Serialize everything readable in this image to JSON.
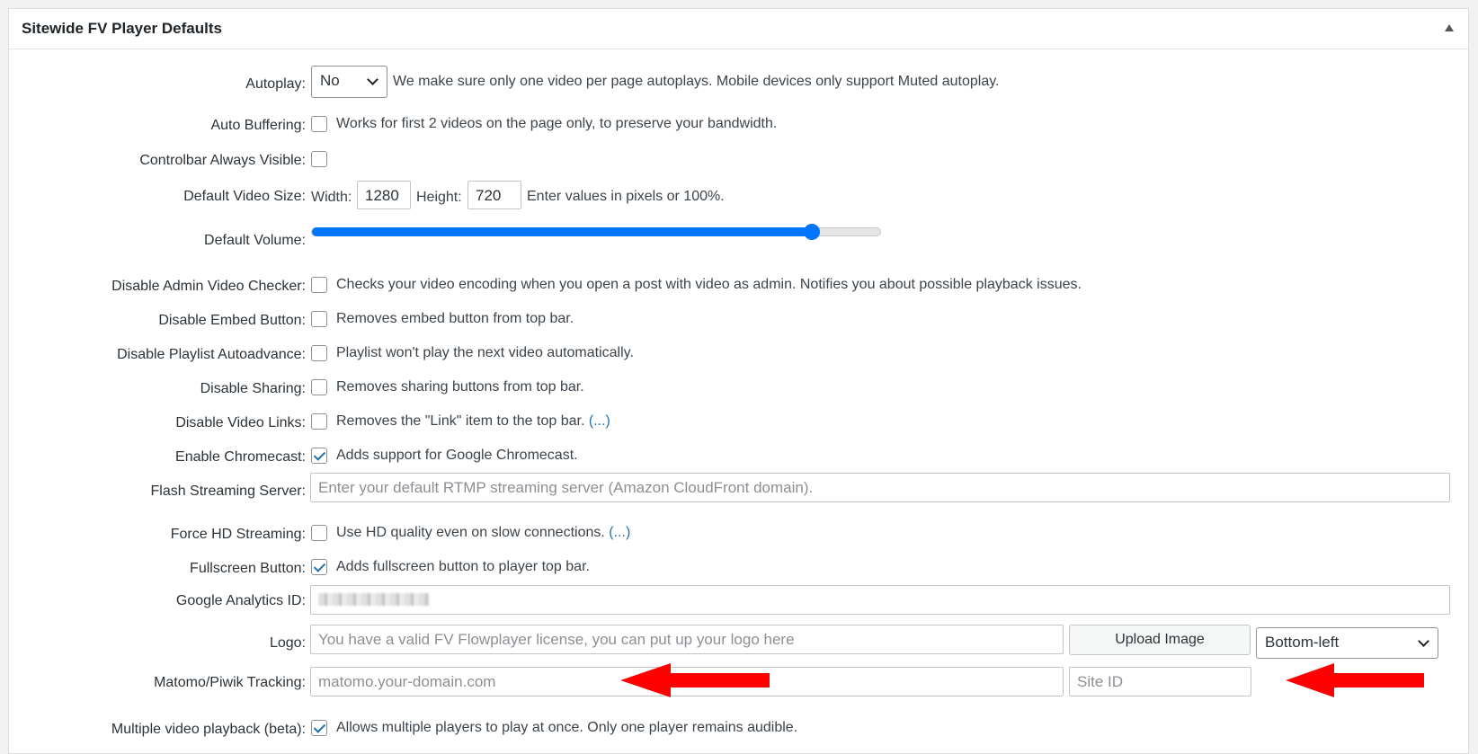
{
  "panel": {
    "title": "Sitewide FV Player Defaults"
  },
  "settings": {
    "autoplay": {
      "label": "Autoplay:",
      "value": "No",
      "desc": "We make sure only one video per page autoplays. Mobile devices only support Muted autoplay."
    },
    "auto_buffering": {
      "label": "Auto Buffering:",
      "checked": false,
      "desc": "Works for first 2 videos on the page only, to preserve your bandwidth."
    },
    "controlbar": {
      "label": "Controlbar Always Visible:",
      "checked": false
    },
    "video_size": {
      "label": "Default Video Size:",
      "width_label": "Width:",
      "width": "1280",
      "height_label": "Height:",
      "height": "720",
      "desc": "Enter values in pixels or 100%."
    },
    "volume": {
      "label": "Default Volume:",
      "level": 0.88
    },
    "admin_checker": {
      "label": "Disable Admin Video Checker:",
      "checked": false,
      "desc": "Checks your video encoding when you open a post with video as admin. Notifies you about possible playback issues."
    },
    "embed_button": {
      "label": "Disable Embed Button:",
      "checked": false,
      "desc": "Removes embed button from top bar."
    },
    "playlist_autoadvance": {
      "label": "Disable Playlist Autoadvance:",
      "checked": false,
      "desc": "Playlist won't play the next video automatically."
    },
    "sharing": {
      "label": "Disable Sharing:",
      "checked": false,
      "desc": "Removes sharing buttons from top bar."
    },
    "video_links": {
      "label": "Disable Video Links:",
      "checked": false,
      "desc": "Removes the \"Link\" item to the top bar.",
      "more": "(...)"
    },
    "chromecast": {
      "label": "Enable Chromecast:",
      "checked": true,
      "desc": "Adds support for Google Chromecast."
    },
    "flash_server": {
      "label": "Flash Streaming Server:",
      "placeholder": "Enter your default RTMP streaming server (Amazon CloudFront domain)."
    },
    "force_hd": {
      "label": "Force HD Streaming:",
      "checked": false,
      "desc": "Use HD quality even on slow connections.",
      "more": "(...)"
    },
    "fullscreen": {
      "label": "Fullscreen Button:",
      "checked": true,
      "desc": "Adds fullscreen button to player top bar."
    },
    "ga_id": {
      "label": "Google Analytics ID:"
    },
    "logo": {
      "label": "Logo:",
      "placeholder": "You have a valid FV Flowplayer license, you can put up your logo here",
      "upload_label": "Upload Image",
      "position": "Bottom-left"
    },
    "matomo": {
      "label": "Matomo/Piwik Tracking:",
      "domain_placeholder": "matomo.your-domain.com",
      "site_placeholder": "Site ID"
    },
    "multiple_playback": {
      "label": "Multiple video playback (beta):",
      "checked": true,
      "desc": "Allows multiple players to play at once. Only one player remains audible."
    }
  },
  "colors": {
    "accent": "#2271b1",
    "slider": "#0075ff",
    "annotation_arrow": "#ff0000"
  }
}
